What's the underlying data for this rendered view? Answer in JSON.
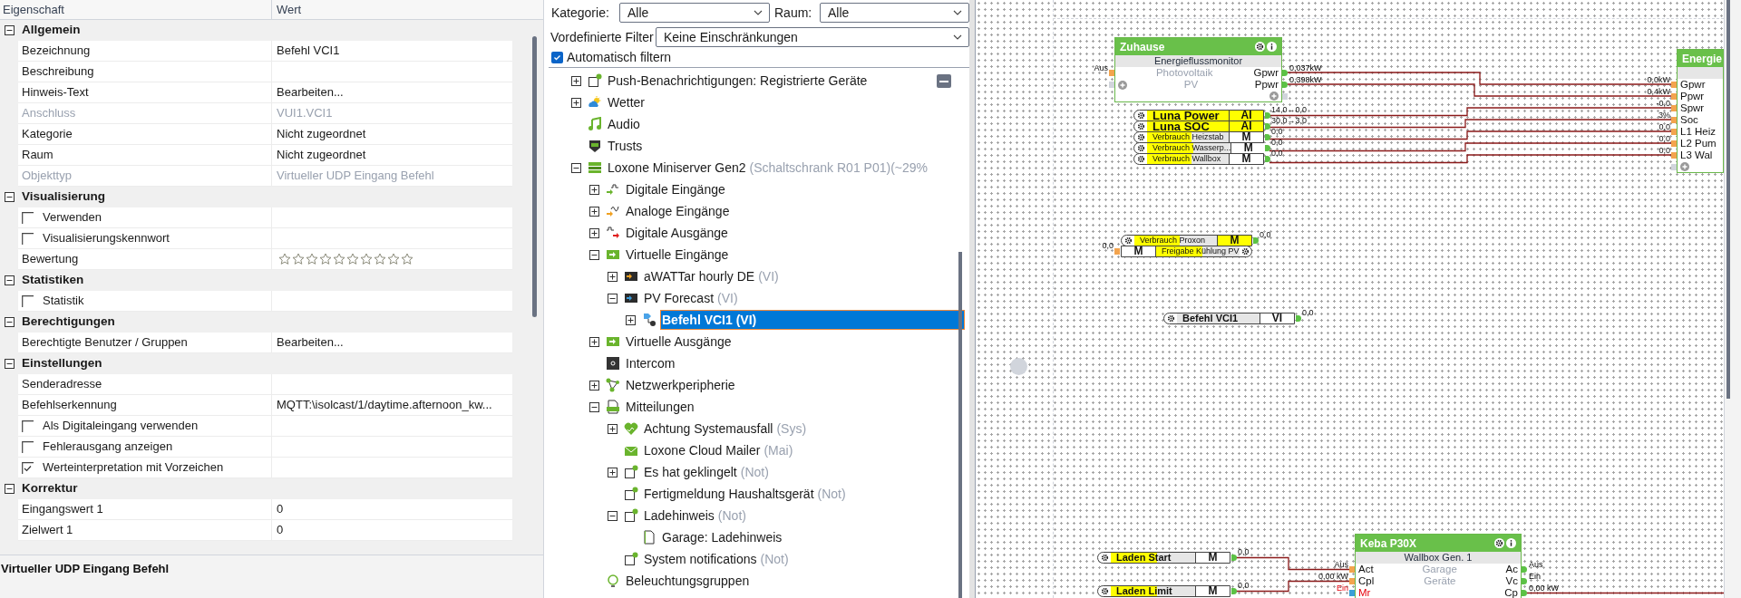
{
  "properties": {
    "columns": [
      "Eigenschaft",
      "Wert"
    ],
    "groups": [
      {
        "title": "Allgemein",
        "expanded": true,
        "rows": [
          {
            "kind": "text",
            "label": "Bezeichnung",
            "value": "Befehl VCI1",
            "disabled": false
          },
          {
            "kind": "text",
            "label": "Beschreibung",
            "disabled": false
          },
          {
            "kind": "text",
            "label": "Hinweis-Text",
            "value": "Bearbeiten...",
            "disabled": false
          },
          {
            "kind": "text",
            "label": "Anschluss",
            "value": "VUI1.VCI1",
            "disabled": true
          },
          {
            "kind": "text",
            "label": "Kategorie",
            "value": "Nicht zugeordnet",
            "disabled": false
          },
          {
            "kind": "text",
            "label": "Raum",
            "value": "Nicht zugeordnet",
            "disabled": false
          },
          {
            "kind": "text",
            "label": "Objekttyp",
            "value": "Virtueller UDP Eingang Befehl",
            "disabled": true
          }
        ]
      },
      {
        "title": "Visualisierung",
        "expanded": true,
        "rows": [
          {
            "kind": "checkbox",
            "label": "Verwenden",
            "checked": false
          },
          {
            "kind": "checkbox",
            "label": "Visualisierungskennwort",
            "checked": false
          },
          {
            "kind": "rating",
            "label": "Bewertung",
            "stars": 0
          }
        ]
      },
      {
        "title": "Statistiken",
        "expanded": true,
        "rows": [
          {
            "kind": "checkbox",
            "label": "Statistik",
            "checked": false
          }
        ]
      },
      {
        "title": "Berechtigungen",
        "expanded": true,
        "rows": [
          {
            "kind": "text",
            "label": "Berechtigte Benutzer / Gruppen",
            "value": "Bearbeiten...",
            "disabled": false
          }
        ]
      },
      {
        "title": "Einstellungen",
        "expanded": true,
        "rows": [
          {
            "kind": "text",
            "label": "Senderadresse",
            "disabled": false
          },
          {
            "kind": "text",
            "label": "Befehlserkennung",
            "value": "MQTT:\\isolcast/1/daytime.afternoon_kw...",
            "disabled": false
          },
          {
            "kind": "checkbox",
            "label": "Als Digitaleingang verwenden",
            "checked": false
          },
          {
            "kind": "checkbox",
            "label": "Fehlerausgang anzeigen",
            "checked": false
          },
          {
            "kind": "checkbox",
            "label": "Werteinterpretation mit Vorzeichen",
            "checked": true
          }
        ]
      },
      {
        "title": "Korrektur",
        "expanded": true,
        "rows": [
          {
            "kind": "text",
            "label": "Eingangswert 1",
            "value": "0",
            "disabled": false
          },
          {
            "kind": "text",
            "label": "Zielwert 1",
            "value": "0",
            "disabled": false
          }
        ]
      }
    ],
    "description": "Virtueller UDP Eingang Befehl"
  },
  "filters": {
    "category_label": "Kategorie:",
    "category": "Alle",
    "room_label": "Raum:",
    "room": "Alle",
    "preset_label": "Vordefinierte Filter",
    "preset": "Keine Einschränkungen",
    "auto_filter": {
      "label": "Automatisch filtern",
      "checked": true
    }
  },
  "tree": [
    {
      "label": "Push-Benachrichtigungen: Registrierte Geräte",
      "kind": "branch",
      "expanded": false,
      "selected": false
    },
    {
      "label": "Wetter",
      "kind": "branch",
      "expanded": false,
      "selected": false
    },
    {
      "label": "Audio",
      "kind": "leaf",
      "selected": false
    },
    {
      "label": "Trusts",
      "kind": "leaf",
      "selected": false
    },
    {
      "label": "Loxone Miniserver Gen2",
      "suffix": "(Schaltschrank R01 P01)(~29%",
      "kind": "branch",
      "expanded": true,
      "selected": false,
      "children": [
        {
          "label": "Digitale Eingänge",
          "kind": "branch",
          "expanded": false,
          "selected": false
        },
        {
          "label": "Analoge Eingänge",
          "kind": "branch",
          "expanded": false,
          "selected": false
        },
        {
          "label": "Digitale Ausgänge",
          "kind": "branch",
          "expanded": false,
          "selected": false
        },
        {
          "label": "Virtuelle Eingänge",
          "kind": "branch",
          "expanded": true,
          "selected": false,
          "children": [
            {
              "label": "aWATTar hourly DE",
              "suffix": "(VI)",
              "kind": "branch",
              "expanded": false,
              "selected": false
            },
            {
              "label": "PV Forecast",
              "suffix": "(VI)",
              "kind": "branch",
              "expanded": true,
              "selected": false,
              "children": [
                {
                  "label": "Befehl VCI1 (VI)",
                  "kind": "branch",
                  "expanded": false,
                  "selected": true
                }
              ]
            }
          ]
        },
        {
          "label": "Virtuelle Ausgänge",
          "kind": "branch",
          "expanded": false,
          "selected": false
        },
        {
          "label": "Intercom",
          "kind": "leaf",
          "selected": false
        },
        {
          "label": "Netzwerkperipherie",
          "kind": "branch",
          "expanded": false,
          "selected": false
        },
        {
          "label": "Mitteilungen",
          "kind": "branch",
          "expanded": true,
          "selected": false,
          "children": [
            {
              "label": "Achtung Systemausfall",
              "suffix": "(Sys)",
              "kind": "branch",
              "expanded": false,
              "selected": false
            },
            {
              "label": "Loxone Cloud Mailer",
              "suffix": "(Mai)",
              "kind": "leaf",
              "selected": false
            },
            {
              "label": "Es hat geklingelt",
              "suffix": "(Not)",
              "kind": "branch",
              "expanded": false,
              "selected": false
            },
            {
              "label": "Fertigmeldung Haushaltsgerät",
              "suffix": "(Not)",
              "kind": "leaf",
              "selected": false
            },
            {
              "label": "Ladehinweis",
              "suffix": "(Not)",
              "kind": "branch",
              "expanded": true,
              "selected": false,
              "children": [
                {
                  "label": "Garage: Ladehinweis",
                  "kind": "leaf",
                  "selected": false
                }
              ]
            },
            {
              "label": "System notifications",
              "suffix": "(Not)",
              "kind": "leaf",
              "selected": false
            }
          ]
        },
        {
          "label": "Beleuchtungsgruppen",
          "kind": "leaf",
          "selected": false
        }
      ]
    }
  ],
  "canvas": {
    "function_blocks": [
      {
        "title": "Zuhause",
        "subtitle": "Energieflussmonitor",
        "inputs": [
          {
            "value": "Aus",
            "alert": false
          }
        ],
        "center": [
          "Photovoltaik",
          "PV"
        ],
        "outputs": [
          {
            "label": "Gpwr",
            "value": "0,037kW"
          },
          {
            "label": "Ppwr",
            "value": "0,398kW"
          }
        ]
      },
      {
        "title": "Energie",
        "inputs": [
          {
            "label": "Gpwr",
            "value": "0,0kW",
            "alert": false
          },
          {
            "label": "Ppwr",
            "value": "0,4kW",
            "alert": false
          },
          {
            "label": "Spwr",
            "value": "-0,0",
            "alert": false
          },
          {
            "label": "Soc",
            "value": "3%",
            "alert": false
          },
          {
            "label": "L1 Heiz",
            "value": "0,0",
            "alert": false
          },
          {
            "label": "L2 Pum",
            "value": "0,0",
            "alert": false
          },
          {
            "label": "L3 Wal",
            "value": "0,0",
            "alert": false
          }
        ]
      },
      {
        "title": "Keba P30X",
        "subtitle": "Wallbox Gen. 1",
        "inputs": [
          {
            "label": "Act",
            "value": "Aus",
            "alert": false
          },
          {
            "label": "Cpl",
            "value": "0,00 kW",
            "alert": false
          },
          {
            "label": "Mr",
            "value": "Ein",
            "alert": true
          }
        ],
        "center": [
          "Garage",
          "Geräte"
        ],
        "outputs": [
          {
            "label": "Ac",
            "value": "Aus"
          },
          {
            "label": "Vc",
            "value": "Ein"
          },
          {
            "label": "Cp",
            "value": "0,00 kW"
          }
        ]
      }
    ],
    "reference_groups": [
      {
        "rows": [
          {
            "name": "Luna Power",
            "type": "AI",
            "value": "14,0→0,0",
            "kind": "output",
            "bold": true,
            "large": true,
            "name_highlighted": true,
            "partial_highlight": false,
            "type_highlighted": true
          },
          {
            "name": "Luna SOC",
            "type": "AI",
            "value": "30,0→3,0",
            "kind": "output",
            "bold": true,
            "large": true,
            "name_highlighted": true,
            "partial_highlight": false,
            "type_highlighted": true
          },
          {
            "name": "Verbrauch Heizstab",
            "type": "M",
            "value": "0,0",
            "kind": "output",
            "bold": false,
            "large": false,
            "name_highlighted": true,
            "partial_highlight": true,
            "type_highlighted": false
          },
          {
            "name": "Verbrauch Wasserp...",
            "type": "M",
            "value": "0,0",
            "kind": "output",
            "bold": false,
            "large": false,
            "name_highlighted": true,
            "partial_highlight": true,
            "type_highlighted": false
          },
          {
            "name": "Verbrauch Wallbox",
            "type": "M",
            "value": "0,0",
            "kind": "output",
            "bold": false,
            "large": false,
            "name_highlighted": true,
            "partial_highlight": true,
            "type_highlighted": false
          }
        ]
      },
      {
        "rows": [
          {
            "name": "Verbrauch Proxon",
            "type": "M",
            "value": "0,0",
            "kind": "output",
            "bold": false,
            "large": false,
            "name_highlighted": true,
            "partial_highlight": true,
            "type_highlighted": true
          },
          {
            "name": "Freigabe Kühlung PV",
            "type": "M",
            "value": "0,0",
            "kind": "input",
            "bold": false,
            "large": false,
            "name_highlighted": true,
            "partial_highlight": true,
            "type_highlighted": false
          }
        ]
      },
      {
        "rows": [
          {
            "name": "Befehl VCI1",
            "type": "VI",
            "value": "0,0",
            "kind": "output",
            "bold": true,
            "large": false,
            "name_highlighted": false,
            "type_highlighted": false
          }
        ]
      },
      {
        "rows": [
          {
            "name": "Laden Start",
            "type": "M",
            "value": "0,0",
            "kind": "output",
            "bold": true,
            "large": false,
            "name_highlighted": true,
            "partial_highlight": true,
            "type_highlighted": false
          }
        ]
      },
      {
        "rows": [
          {
            "name": "Laden Limit",
            "type": "M",
            "value": "0,0",
            "kind": "output",
            "bold": true,
            "large": false,
            "name_highlighted": true,
            "partial_highlight": true,
            "type_highlighted": false
          }
        ]
      }
    ]
  }
}
